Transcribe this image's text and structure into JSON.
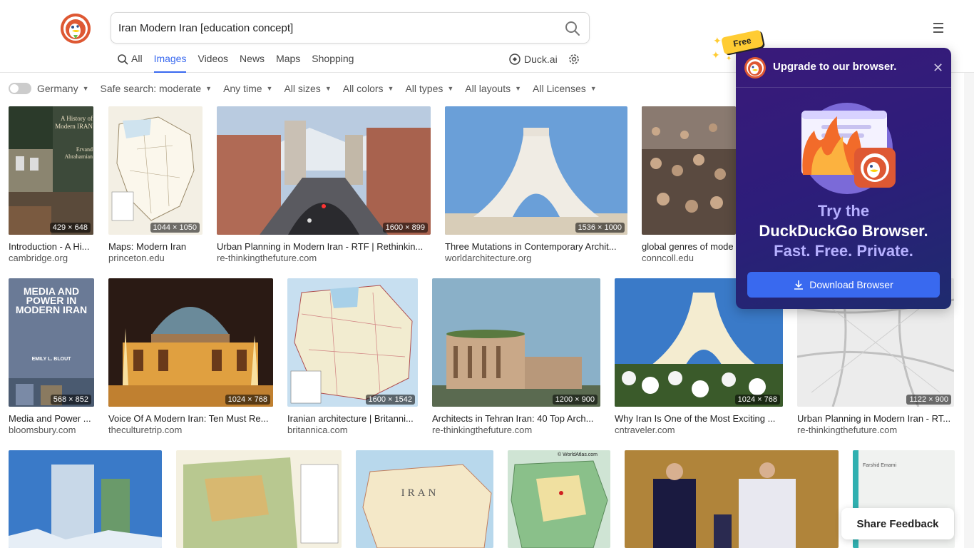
{
  "search": {
    "query": "Iran Modern Iran [education concept]"
  },
  "tabs": [
    {
      "label": "All"
    },
    {
      "label": "Images"
    },
    {
      "label": "Videos"
    },
    {
      "label": "News"
    },
    {
      "label": "Maps"
    },
    {
      "label": "Shopping"
    }
  ],
  "duck_ai": {
    "label": "Duck.ai"
  },
  "filters": {
    "region": "Germany",
    "safe_search": "Safe search: moderate",
    "time": "Any time",
    "size": "All sizes",
    "color": "All colors",
    "type": "All types",
    "layout": "All layouts",
    "license": "All Licenses"
  },
  "results": [
    {
      "title": "Introduction - A Hi...",
      "domain": "cambridge.org",
      "dims": "429 × 648"
    },
    {
      "title": "Maps: Modern Iran",
      "domain": "princeton.edu",
      "dims": "1044 × 1050"
    },
    {
      "title": "Urban Planning in Modern Iran - RTF | Rethinkin...",
      "domain": "re-thinkingthefuture.com",
      "dims": "1600 × 899"
    },
    {
      "title": "Three Mutations in Contemporary Archit...",
      "domain": "worldarchitecture.org",
      "dims": "1536 × 1000"
    },
    {
      "title": "global genres of mode",
      "domain": "conncoll.edu",
      "dims": ""
    },
    {
      "title": "Media and Power ...",
      "domain": "bloomsbury.com",
      "dims": "568 × 852"
    },
    {
      "title": "Voice Of A Modern Iran: Ten Must Re...",
      "domain": "theculturetrip.com",
      "dims": "1024 × 768"
    },
    {
      "title": "Iranian architecture | Britanni...",
      "domain": "britannica.com",
      "dims": "1600 × 1542"
    },
    {
      "title": "Architects in Tehran Iran: 40 Top Arch...",
      "domain": "re-thinkingthefuture.com",
      "dims": "1200 × 900"
    },
    {
      "title": "Why Iran Is One of the Most Exciting ...",
      "domain": "cntraveler.com",
      "dims": "1024 × 768"
    },
    {
      "title": "Urban Planning in Modern Iran - RT...",
      "domain": "re-thinkingthefuture.com",
      "dims": "1122 × 900"
    }
  ],
  "image_text": {
    "book1_title": "A History of Modern IRAN",
    "book1_author": "Ervand Abrahamian",
    "book2_title": "MEDIA AND POWER IN MODERN IRAN",
    "book2_author": "EMILY L. BLOUT",
    "map_label": "IRAN",
    "worldatlas": "© WorldAtlas.com",
    "last_book_author": "Farshid Emami"
  },
  "promo": {
    "badge": "Free",
    "header": "Upgrade to our browser.",
    "line1": "Try the",
    "line2": "DuckDuckGo Browser.",
    "line3": "Fast. Free. Private.",
    "button": "Download Browser"
  },
  "feedback": {
    "label": "Share Feedback"
  },
  "colors": {
    "accent": "#3969ef",
    "brand": "#de5833",
    "promo_bg": "#2d1d7a",
    "badge": "#ffcc33"
  }
}
